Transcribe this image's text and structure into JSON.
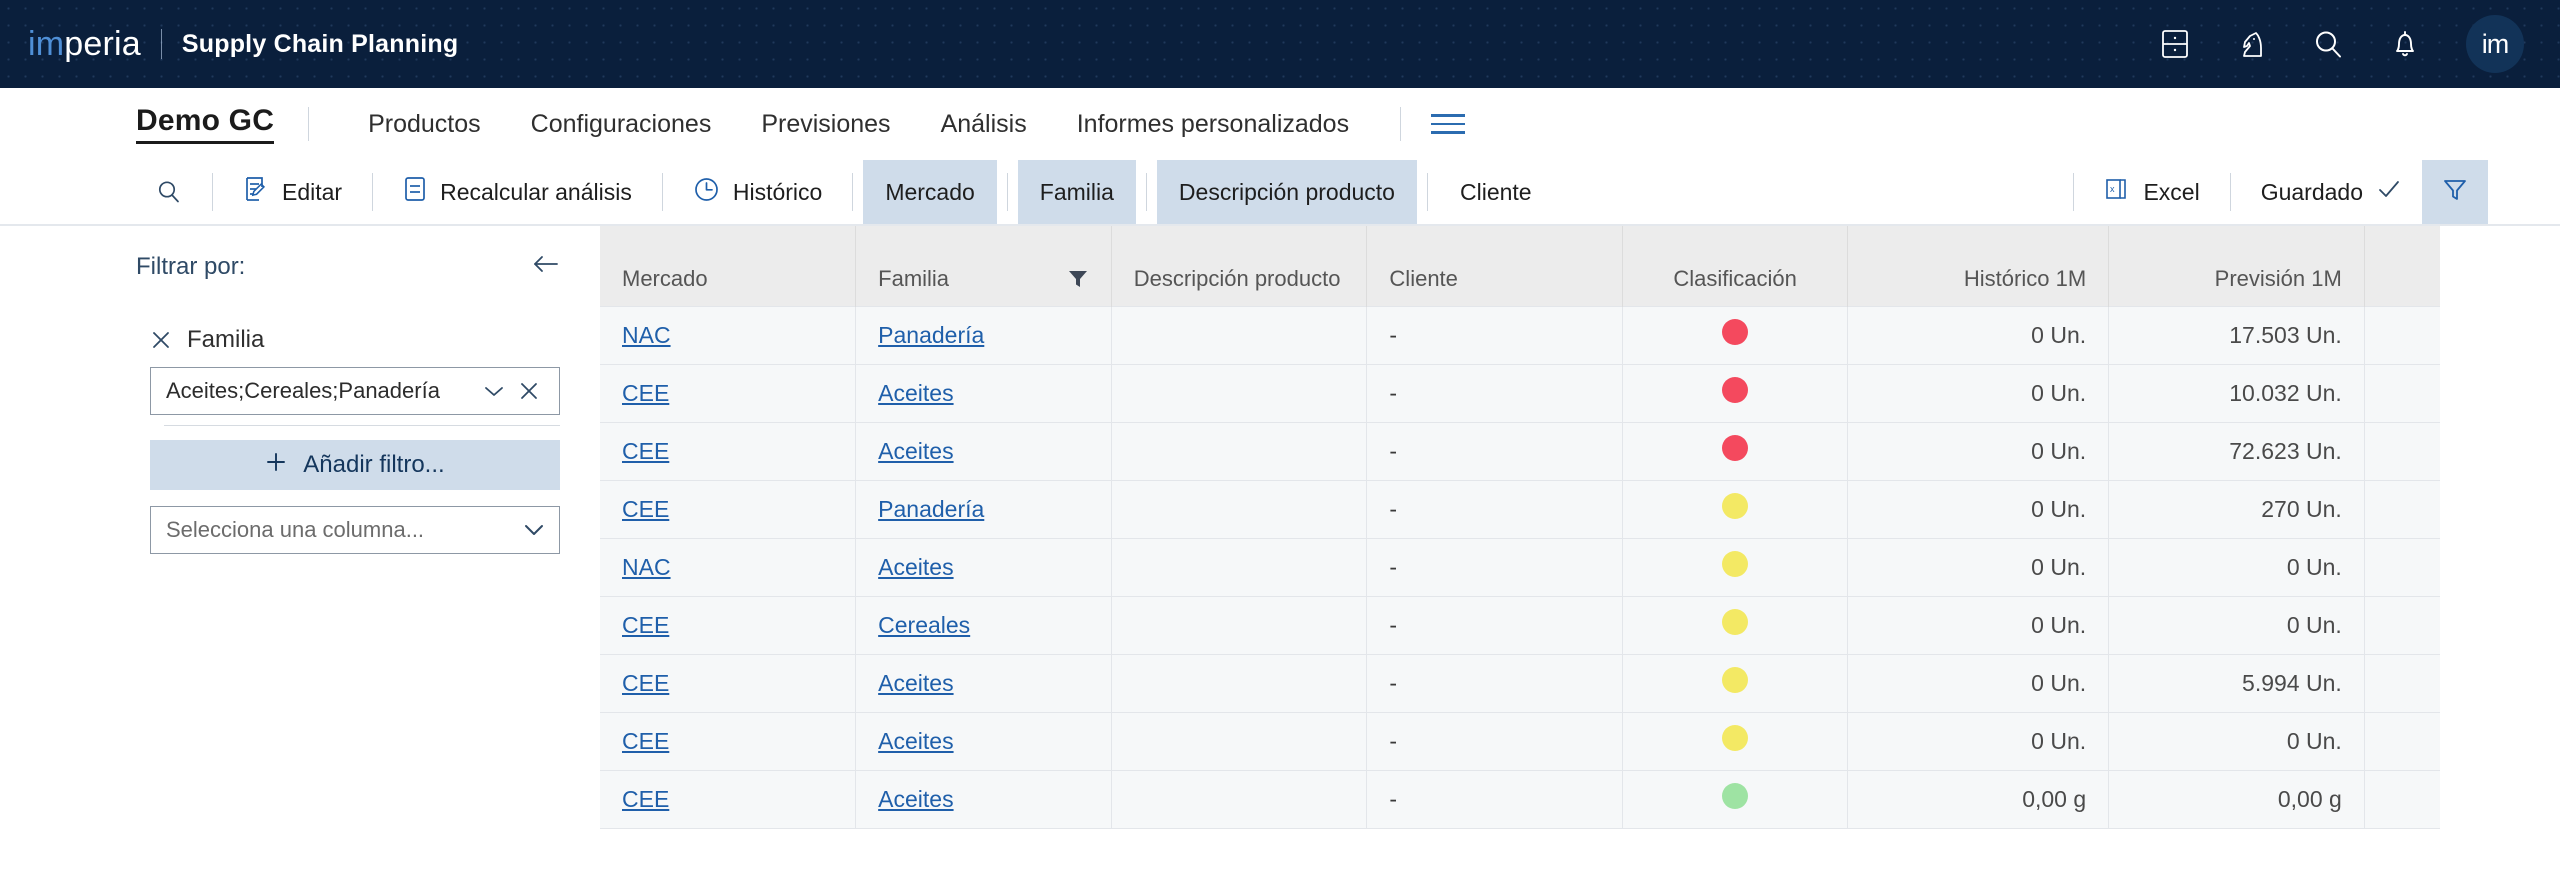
{
  "topbar": {
    "logo_prefix": "im",
    "logo_suffix": "peria",
    "title": "Supply Chain Planning",
    "icons": [
      {
        "name": "database-icon"
      },
      {
        "name": "chess-knight-icon"
      },
      {
        "name": "search-icon"
      },
      {
        "name": "bell-icon"
      }
    ],
    "avatar_label": "im"
  },
  "nav": {
    "workspace": "Demo GC",
    "items": [
      {
        "label": "Productos"
      },
      {
        "label": "Configuraciones"
      },
      {
        "label": "Previsiones"
      },
      {
        "label": "Análisis"
      },
      {
        "label": "Informes personalizados"
      }
    ],
    "menu_icon": "hamburger-icon"
  },
  "toolbar": {
    "search_icon": "search-icon",
    "edit_label": "Editar",
    "recalc_label": "Recalcular análisis",
    "history_label": "Histórico",
    "chips": [
      {
        "label": "Mercado",
        "active": true
      },
      {
        "label": "Familia",
        "active": true
      },
      {
        "label": "Descripción producto",
        "active": true
      },
      {
        "label": "Cliente",
        "active": false
      }
    ],
    "excel_label": "Excel",
    "saved_label": "Guardado",
    "filter_icon": "filter-funnel-icon"
  },
  "filter_panel": {
    "title": "Filtrar por:",
    "collapse_icon": "arrow-left-icon",
    "field_label": "Familia",
    "field_value": "Aceites;Cereales;Panadería",
    "add_filter_label": "Añadir filtro...",
    "column_select_placeholder": "Selecciona una columna..."
  },
  "table": {
    "columns": [
      {
        "key": "mercado",
        "label": "Mercado",
        "align": "left",
        "filtered": false
      },
      {
        "key": "familia",
        "label": "Familia",
        "align": "left",
        "filtered": true
      },
      {
        "key": "desc",
        "label": "Descripción producto",
        "align": "left",
        "filtered": false
      },
      {
        "key": "cliente",
        "label": "Cliente",
        "align": "left",
        "filtered": false
      },
      {
        "key": "clasif",
        "label": "Clasificación",
        "align": "center",
        "filtered": false
      },
      {
        "key": "hist",
        "label": "Histórico 1M",
        "align": "right",
        "filtered": false
      },
      {
        "key": "prev",
        "label": "Previsión 1M",
        "align": "right",
        "filtered": false
      }
    ],
    "classification_colors": {
      "red": "#f4495e",
      "yellow": "#f3e964",
      "green": "#9ee3a3"
    },
    "rows": [
      {
        "mercado": "NAC",
        "familia": "Panadería",
        "desc": "",
        "cliente": "-",
        "clasif": "red",
        "hist": "0 Un.",
        "prev": "17.503 Un."
      },
      {
        "mercado": "CEE",
        "familia": "Aceites",
        "desc": "",
        "cliente": "-",
        "clasif": "red",
        "hist": "0 Un.",
        "prev": "10.032 Un."
      },
      {
        "mercado": "CEE",
        "familia": "Aceites",
        "desc": "",
        "cliente": "-",
        "clasif": "red",
        "hist": "0 Un.",
        "prev": "72.623 Un."
      },
      {
        "mercado": "CEE",
        "familia": "Panadería",
        "desc": "",
        "cliente": "-",
        "clasif": "yellow",
        "hist": "0 Un.",
        "prev": "270 Un."
      },
      {
        "mercado": "NAC",
        "familia": "Aceites",
        "desc": "",
        "cliente": "-",
        "clasif": "yellow",
        "hist": "0 Un.",
        "prev": "0 Un."
      },
      {
        "mercado": "CEE",
        "familia": "Cereales",
        "desc": "",
        "cliente": "-",
        "clasif": "yellow",
        "hist": "0 Un.",
        "prev": "0 Un."
      },
      {
        "mercado": "CEE",
        "familia": "Aceites",
        "desc": "",
        "cliente": "-",
        "clasif": "yellow",
        "hist": "0 Un.",
        "prev": "5.994 Un."
      },
      {
        "mercado": "CEE",
        "familia": "Aceites",
        "desc": "",
        "cliente": "-",
        "clasif": "yellow",
        "hist": "0 Un.",
        "prev": "0 Un."
      },
      {
        "mercado": "CEE",
        "familia": "Aceites",
        "desc": "",
        "cliente": "-",
        "clasif": "green",
        "hist": "0,00 g",
        "prev": "0,00 g"
      }
    ]
  }
}
